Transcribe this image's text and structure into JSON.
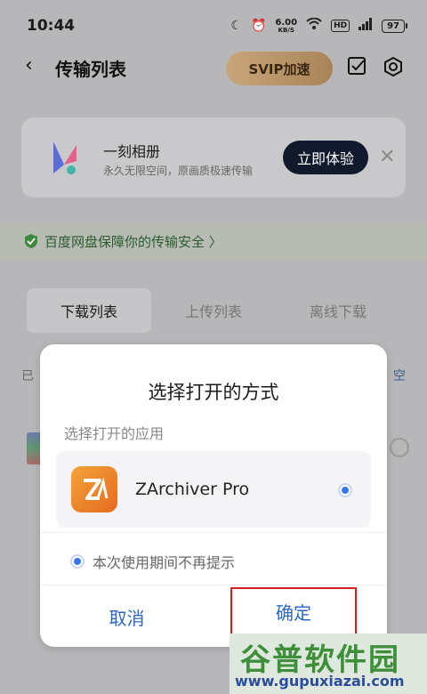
{
  "status": {
    "time": "10:44",
    "net_speed": "6.00",
    "net_unit": "KB/S",
    "hd": "HD",
    "battery": "97"
  },
  "header": {
    "title": "传输列表",
    "svip": "SVIP加速"
  },
  "promo": {
    "title": "一刻相册",
    "subtitle": "永久无限空间，原画质极速传输",
    "cta": "立即体验"
  },
  "security": {
    "text": "百度网盘保障你的传输安全 〉"
  },
  "tabs": [
    {
      "label": "下载列表",
      "active": true
    },
    {
      "label": "上传列表",
      "active": false
    },
    {
      "label": "离线下载",
      "active": false
    }
  ],
  "background": {
    "left_text": "已",
    "right_text": "空"
  },
  "dialog": {
    "title": "选择打开的方式",
    "subtitle": "选择打开的应用",
    "app_name": "ZArchiver Pro",
    "remember": "本次使用期间不再提示",
    "cancel": "取消",
    "confirm": "确定"
  },
  "watermark": {
    "top": "谷普软件园",
    "bottom": "www.gupuxiazai.com"
  },
  "colors": {
    "accent": "#2a67c9",
    "radio": "#3b79e8",
    "highlight_border": "#d81e1e"
  }
}
